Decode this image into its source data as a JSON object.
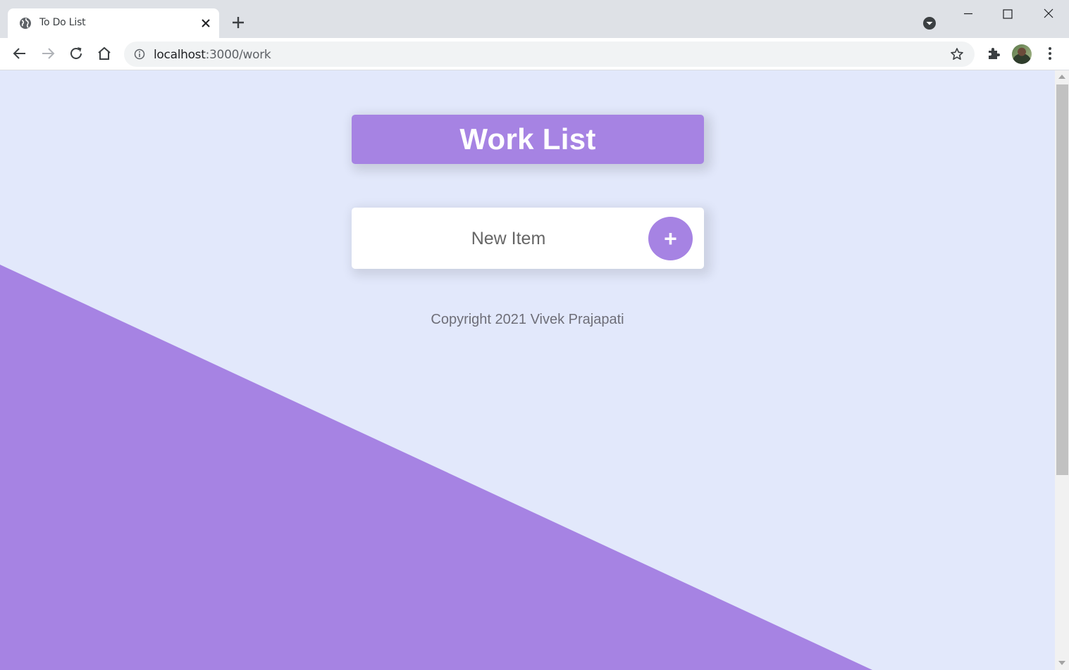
{
  "browser": {
    "tab_title": "To Do List",
    "url_host": "localhost",
    "url_path": ":3000/work",
    "icons": {
      "favicon": "globe-icon",
      "tab_close": "close-icon",
      "new_tab": "plus-icon",
      "tab_search": "chevron-down-circle-icon",
      "back": "arrow-left-icon",
      "forward": "arrow-right-icon",
      "reload": "reload-icon",
      "home": "home-icon",
      "site_info": "info-icon",
      "bookmark": "star-icon",
      "extensions": "puzzle-icon",
      "menu": "kebab-menu-icon"
    }
  },
  "page": {
    "heading": "Work List",
    "new_item_placeholder": "New Item",
    "add_button_label": "+",
    "footer": "Copyright 2021 Vivek Prajapati"
  },
  "colors": {
    "accent": "#a683e3",
    "background": "#e2e8fb",
    "card": "#ffffff",
    "chrome_tabstrip": "#dee1e6"
  }
}
